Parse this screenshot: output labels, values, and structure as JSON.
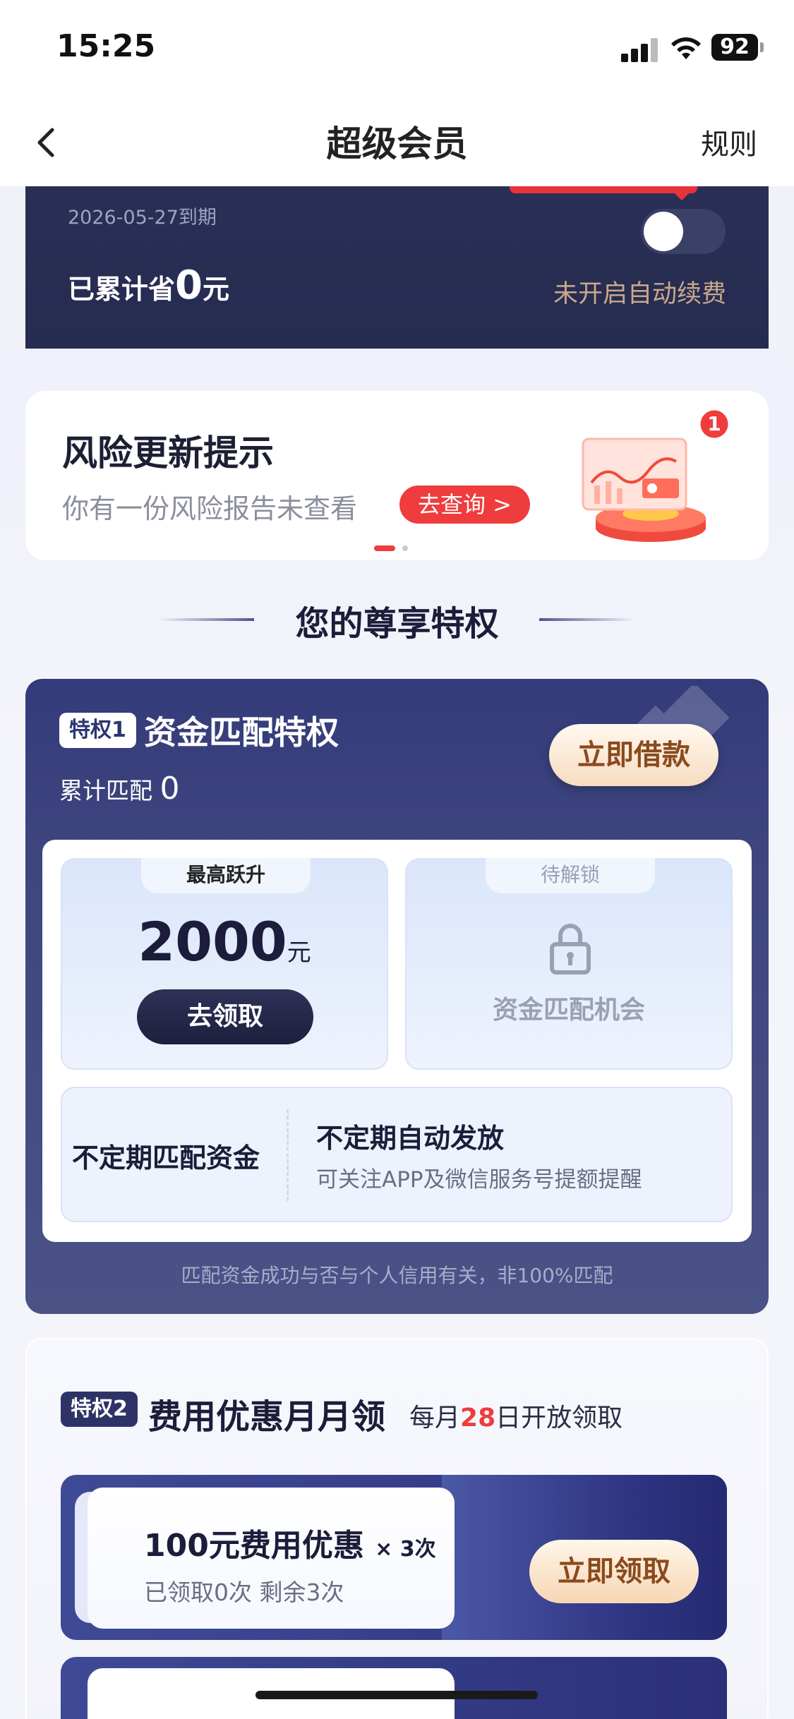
{
  "status_bar": {
    "time": "15:25",
    "battery": "92"
  },
  "nav": {
    "title": "超级会员",
    "rule": "规则"
  },
  "member": {
    "expire": "2026-05-27到期",
    "saved_prefix": "已累计省",
    "saved_amount": "0",
    "saved_unit": "元",
    "auto_renew": "未开启自动续费"
  },
  "risk": {
    "title": "风险更新提示",
    "subtitle": "你有一份风险报告未查看",
    "button": "去查询 >",
    "notification_count": "1"
  },
  "privileges_heading": "您的尊享特权",
  "privilege1": {
    "badge": "特权1",
    "title": "资金匹配特权",
    "matched_label": "累计匹配",
    "matched_value": "0",
    "borrow_button": "立即借款",
    "tile1_tab": "最高跃升",
    "tile1_amount": "2000",
    "tile1_unit": "元",
    "tile1_button": "去领取",
    "tile2_tab": "待解锁",
    "tile2_text": "资金匹配机会",
    "wide_left": "不定期匹配资金",
    "wide_right_title": "不定期自动发放",
    "wide_right_sub": "可关注APP及微信服务号提额提醒",
    "note": "匹配资金成功与否与个人信用有关，非100%匹配"
  },
  "privilege2": {
    "badge": "特权2",
    "title": "费用优惠月月领",
    "sub_prefix": "每月",
    "sub_day": "28",
    "sub_suffix": "日开放领取",
    "coupon_title": "100元费用优惠",
    "coupon_times": "× 3次",
    "coupon_status": "已领取0次 剩余3次",
    "coupon_button": "立即领取"
  },
  "colors": {
    "accent_red": "#ef3c3c",
    "navy": "#2d3366",
    "gold_text": "#8a4a1d"
  }
}
